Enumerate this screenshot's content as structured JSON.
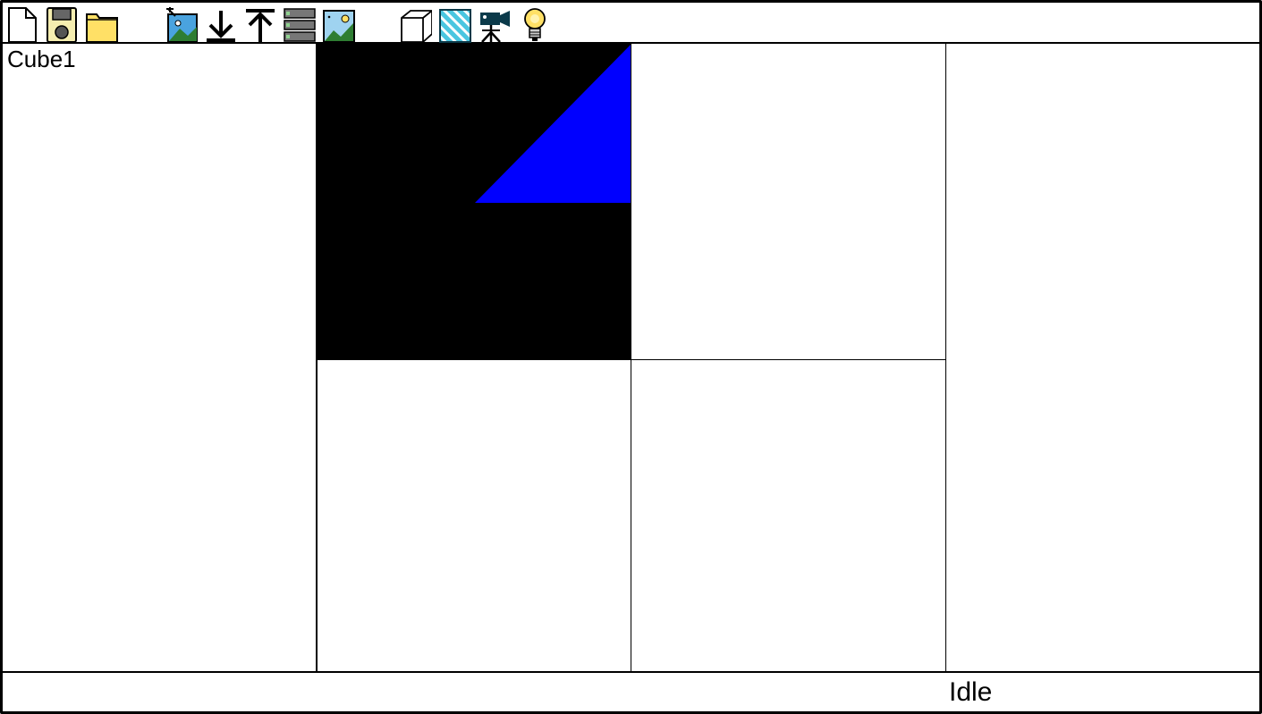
{
  "toolbar": {
    "buttons": [
      {
        "name": "new-file",
        "icon": "new-file-icon"
      },
      {
        "name": "save",
        "icon": "save-icon"
      },
      {
        "name": "open-folder",
        "icon": "folder-icon"
      },
      {
        "name": "import-image",
        "icon": "import-image-icon"
      },
      {
        "name": "move-down",
        "icon": "arrow-down-bar-icon"
      },
      {
        "name": "move-up",
        "icon": "arrow-up-bar-icon"
      },
      {
        "name": "list-layers",
        "icon": "stack-list-icon"
      },
      {
        "name": "render-image",
        "icon": "image-icon"
      },
      {
        "name": "add-cube",
        "icon": "cube-icon"
      },
      {
        "name": "add-plane",
        "icon": "striped-plane-icon"
      },
      {
        "name": "add-camera",
        "icon": "camera-tripod-icon"
      },
      {
        "name": "add-light",
        "icon": "light-bulb-icon"
      }
    ]
  },
  "tree": {
    "items": [
      "Cube1"
    ]
  },
  "status": {
    "text": "Idle"
  },
  "colors": {
    "viewport_bg": "#000000",
    "shape_fill": "#0000ff",
    "icon_blue": "#4aa3df",
    "icon_yellow": "#ffe066",
    "icon_green": "#2e7d32",
    "icon_dark": "#0b3a4a"
  }
}
